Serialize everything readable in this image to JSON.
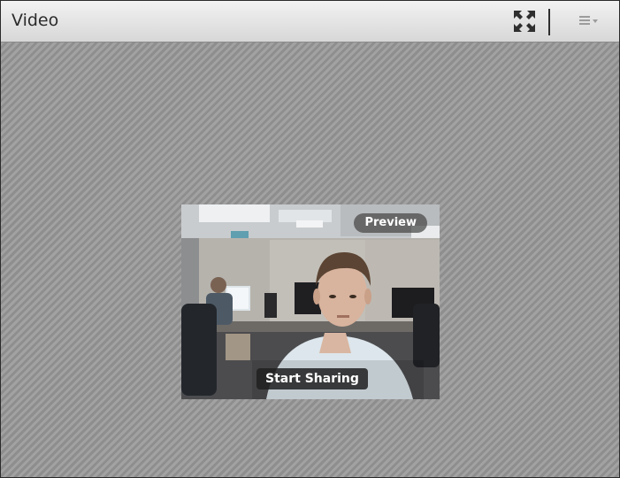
{
  "pod": {
    "title": "Video",
    "fullscreen_icon": "fullscreen-arrows-icon",
    "menu_icon": "pod-options-menu-icon"
  },
  "video": {
    "preview_label": "Preview",
    "start_sharing_label": "Start Sharing"
  },
  "colors": {
    "titlebar_top": "#f2f2f2",
    "titlebar_bottom": "#d7d7d7",
    "stage_stripe_light": "#a2a2a2",
    "stage_stripe_dark": "#8e8e8e",
    "button_bg": "#202020",
    "text_light": "#ffffff"
  }
}
